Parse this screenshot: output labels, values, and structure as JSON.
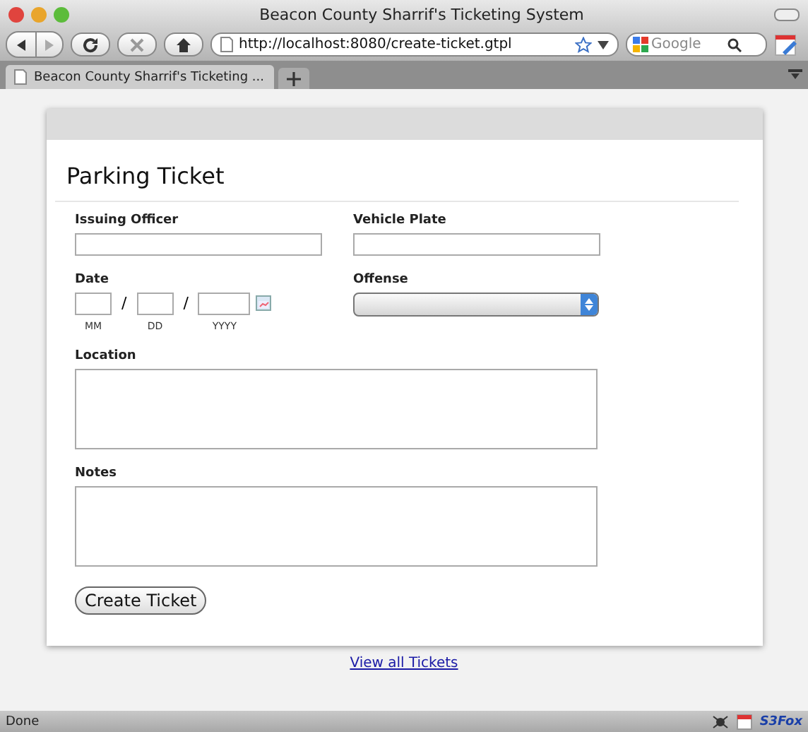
{
  "window": {
    "title": "Beacon County Sharrif's Ticketing System"
  },
  "toolbar": {
    "url": "http://localhost:8080/create-ticket.gtpl",
    "search": {
      "placeholder": "Google"
    }
  },
  "tabs": [
    {
      "label": "Beacon County Sharrif's Ticketing ...",
      "selected": true
    }
  ],
  "form": {
    "title": "Parking Ticket",
    "officer": {
      "label": "Issuing Officer"
    },
    "plate": {
      "label": "Vehicle Plate"
    },
    "date": {
      "label": "Date",
      "separator": "/",
      "parts": [
        "MM",
        "DD",
        "YYYY"
      ]
    },
    "offense": {
      "label": "Offense"
    },
    "location": {
      "label": "Location"
    },
    "notes": {
      "label": "Notes"
    },
    "submit": "Create Ticket"
  },
  "link": "View all Tickets",
  "status_bar": {
    "text": "Done",
    "addon": "S3Fox"
  }
}
